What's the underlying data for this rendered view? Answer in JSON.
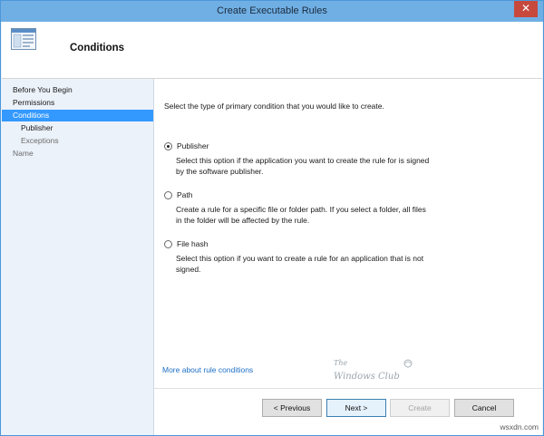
{
  "window": {
    "title": "Create Executable Rules",
    "close_glyph": "✕"
  },
  "header": {
    "title": "Conditions",
    "icon": "window-icon"
  },
  "nav": {
    "items": [
      {
        "label": "Before You Begin"
      },
      {
        "label": "Permissions"
      },
      {
        "label": "Conditions"
      },
      {
        "label": "Publisher"
      },
      {
        "label": "Exceptions"
      },
      {
        "label": "Name"
      }
    ]
  },
  "content": {
    "instruction": "Select the type of primary condition that you would like to create.",
    "options": [
      {
        "label": "Publisher",
        "checked": true,
        "desc_lines": [
          "Select this option if the application you want to create the rule for is signed",
          "by the software publisher."
        ]
      },
      {
        "label": "Path",
        "checked": false,
        "desc_lines": [
          "Create a rule for a specific file or folder path. If you select a folder, all files",
          "in the folder will be affected by the rule."
        ]
      },
      {
        "label": "File hash",
        "checked": false,
        "desc_lines": [
          "Select this option if you want to create a rule for an application that is not",
          "signed."
        ]
      }
    ],
    "link": "More about rule conditions"
  },
  "watermark": {
    "line1": "The",
    "line2": "Windows Club"
  },
  "buttons": {
    "previous": "< Previous",
    "next": "Next >",
    "create": "Create",
    "cancel": "Cancel"
  },
  "site_mark": "wsxdn.com",
  "colors": {
    "titlebar": "#70afe4",
    "selection": "#3399ff",
    "close": "#c7493d",
    "link": "#1c6fc4"
  }
}
